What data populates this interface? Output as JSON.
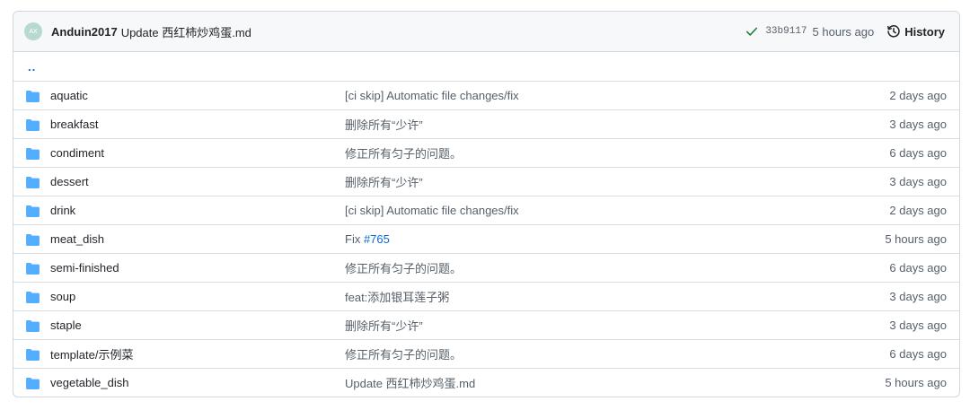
{
  "commit": {
    "avatar_text": "AX",
    "author": "Anduin2017",
    "message": "Update 西红柿炒鸡蛋.md",
    "sha": "33b9117",
    "time": "5 hours ago",
    "history_label": "History"
  },
  "parent_dir": "..",
  "files": [
    {
      "name": "aquatic",
      "message": "[ci skip] Automatic file changes/fix",
      "time": "2 days ago"
    },
    {
      "name": "breakfast",
      "message": "删除所有“少许”",
      "time": "3 days ago"
    },
    {
      "name": "condiment",
      "message": "修正所有匀子的问题。",
      "time": "6 days ago"
    },
    {
      "name": "dessert",
      "message": "删除所有“少许”",
      "time": "3 days ago"
    },
    {
      "name": "drink",
      "message": "[ci skip] Automatic file changes/fix",
      "time": "2 days ago"
    },
    {
      "name": "meat_dish",
      "message": "Fix ",
      "message_link": "#765",
      "time": "5 hours ago"
    },
    {
      "name": "semi-finished",
      "message": "修正所有匀子的问题。",
      "time": "6 days ago"
    },
    {
      "name": "soup",
      "message": "feat:添加银耳莲子粥",
      "time": "3 days ago"
    },
    {
      "name": "staple",
      "message": "删除所有“少许”",
      "time": "3 days ago"
    },
    {
      "name": "template/示例菜",
      "message": "修正所有匀子的问题。",
      "time": "6 days ago"
    },
    {
      "name": "vegetable_dish",
      "message": "Update 西红柿炒鸡蛋.md",
      "time": "5 hours ago"
    }
  ],
  "colors": {
    "folder": "#54aeff",
    "link": "#0969da",
    "check": "#1a7f37"
  }
}
